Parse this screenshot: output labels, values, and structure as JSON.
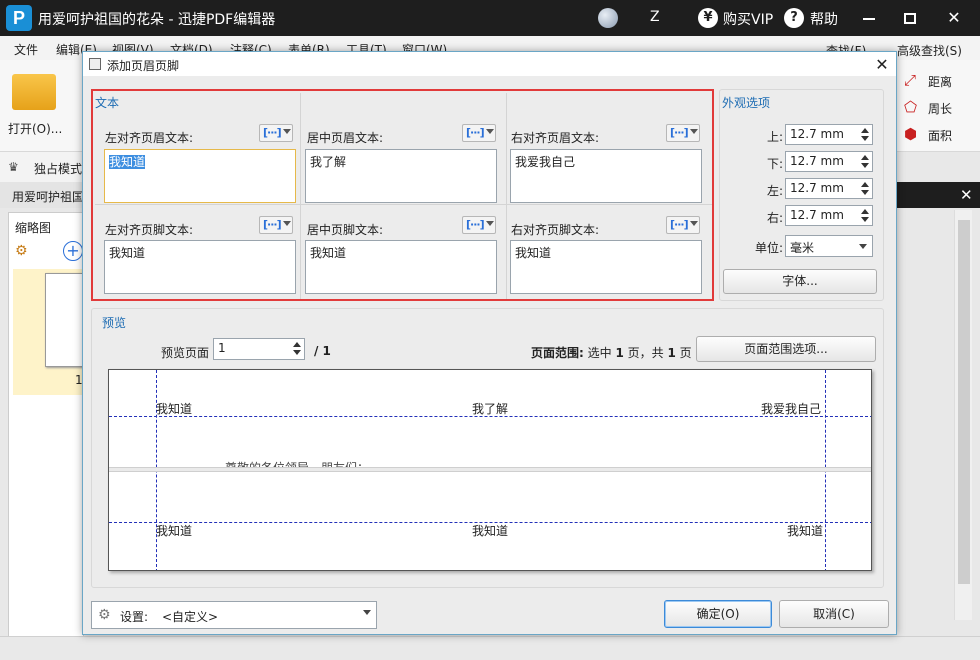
{
  "window": {
    "title": "用爱呵护祖国的花朵 - 迅捷PDF编辑器",
    "user_name": "Z",
    "vip_icon": "¥",
    "vip_label": "购买VIP",
    "help_icon": "?",
    "help_label": "帮助",
    "logo_letter": "P"
  },
  "menubar": {
    "items": [
      "文件",
      "编辑(E)",
      "视图(V)",
      "文档(D)",
      "注释(C)",
      "表单(R)",
      "工具(T)",
      "窗口(W)"
    ]
  },
  "ribbon": {
    "open_label": "打开(O)...",
    "find_label": "查找(F)",
    "adv_find_label": "高级查找(S)",
    "measure": [
      {
        "icon": "distance-icon",
        "label": "距离"
      },
      {
        "icon": "perimeter-icon",
        "label": "周长"
      },
      {
        "icon": "area-icon",
        "label": "面积"
      }
    ]
  },
  "workspace": {
    "mode_label": "独占模式",
    "doc_tab_label": "用爱呵护祖国",
    "thumb_title": "缩略图",
    "thumb_page_number": "1"
  },
  "dialog": {
    "title": "添加页眉页脚",
    "text_group": {
      "label": "文本",
      "fields": [
        {
          "label": "左对齐页眉文本:",
          "value": "我知道",
          "selected": true
        },
        {
          "label": "居中页眉文本:",
          "value": "我了解"
        },
        {
          "label": "右对齐页眉文本:",
          "value": "我爱我自己"
        },
        {
          "label": "左对齐页脚文本:",
          "value": "我知道"
        },
        {
          "label": "居中页脚文本:",
          "value": "我知道"
        },
        {
          "label": "右对齐页脚文本:",
          "value": "我知道"
        }
      ],
      "macro_glyph": "[···]"
    },
    "appearance": {
      "label": "外观选项",
      "margins": [
        {
          "label": "上:",
          "value": "12.7 mm"
        },
        {
          "label": "下:",
          "value": "12.7 mm"
        },
        {
          "label": "左:",
          "value": "12.7 mm"
        },
        {
          "label": "右:",
          "value": "12.7 mm"
        }
      ],
      "unit_label": "单位:",
      "unit_value": "毫米",
      "font_button": "字体..."
    },
    "preview": {
      "label": "预览",
      "page_label": "预览页面",
      "page_value": "1",
      "page_total": "/ 1",
      "range_label": "页面范围:",
      "range_pre": " 选中 ",
      "range_selected": "1",
      "range_mid": " 页，共 ",
      "range_total": "1",
      "range_post": " 页",
      "range_button": "页面范围选项...",
      "header_left": "我知道",
      "header_center": "我了解",
      "header_right": "我爱我自己",
      "footer_left": "我知道",
      "footer_center": "我知道",
      "footer_right": "我知道",
      "body_snippet": "尊敬的各位领导，朋友们："
    },
    "settings_label": "设置:",
    "settings_value": "<自定义>",
    "ok_button": "确定(O)",
    "cancel_button": "取消(C)"
  }
}
